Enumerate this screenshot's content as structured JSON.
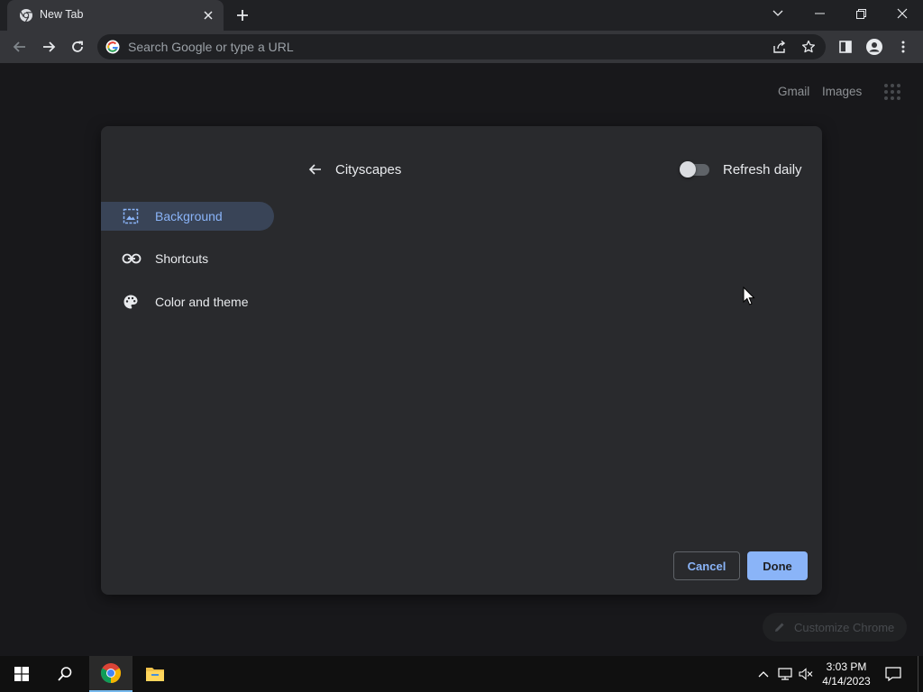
{
  "browser": {
    "tab_title": "New Tab",
    "omnibox_placeholder": "Search Google or type a URL"
  },
  "ntp": {
    "gmail_label": "Gmail",
    "images_label": "Images",
    "customize_label": "Customize Chrome"
  },
  "dialog": {
    "nav_items": [
      {
        "label": "Background",
        "icon": "image-icon",
        "selected": true
      },
      {
        "label": "Shortcuts",
        "icon": "link-icon",
        "selected": false
      },
      {
        "label": "Color and theme",
        "icon": "palette-icon",
        "selected": false
      }
    ],
    "title": "Cityscapes",
    "refresh_label": "Refresh daily",
    "refresh_on": false,
    "cancel_label": "Cancel",
    "done_label": "Done"
  },
  "taskbar": {
    "time": "3:03 PM",
    "date": "4/14/2023"
  },
  "colors": {
    "accent": "#8ab4f8",
    "selected_nav_bg": "#394457",
    "dialog_bg": "#292a2d",
    "page_bg": "#202124"
  }
}
